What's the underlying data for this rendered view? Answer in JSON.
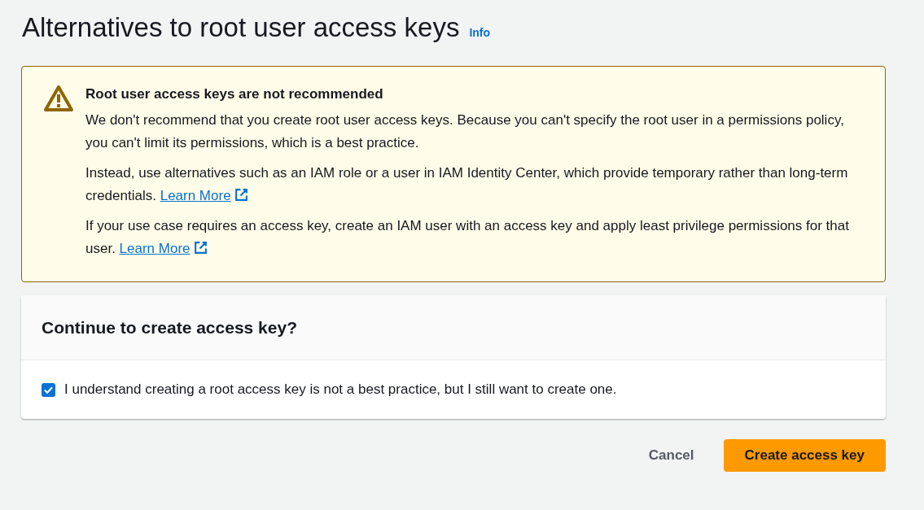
{
  "page": {
    "title": "Alternatives to root user access keys",
    "info_link": "Info"
  },
  "alert": {
    "title": "Root user access keys are not recommended",
    "paragraphs": [
      {
        "text": "We don't recommend that you create root user access keys. Because you can't specify the root user in a permissions policy, you can't limit its permissions, which is a best practice."
      },
      {
        "text": "Instead, use alternatives such as an IAM role or a user in IAM Identity Center, which provide temporary rather than long-term credentials.",
        "link": "Learn More"
      },
      {
        "text": "If your use case requires an access key, create an IAM user with an access key and apply least privilege permissions for that user.",
        "link": "Learn More"
      }
    ]
  },
  "confirm_panel": {
    "title": "Continue to create access key?",
    "checkbox": {
      "label": "I understand creating a root access key is not a best practice, but I still want to create one.",
      "checked": true
    }
  },
  "buttons": [
    {
      "label": "Cancel",
      "kind": "link"
    },
    {
      "label": "Create access key",
      "kind": "primary"
    }
  ]
}
